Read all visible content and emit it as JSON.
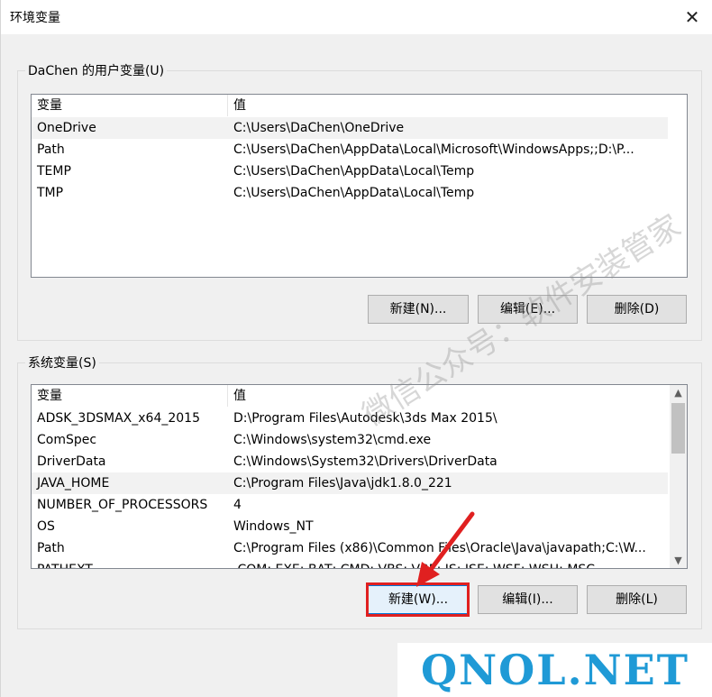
{
  "window": {
    "title": "环境变量",
    "close_glyph": "✕"
  },
  "user_vars": {
    "group_label": "DaChen 的用户变量(U)",
    "headers": [
      "变量",
      "值"
    ],
    "rows": [
      {
        "name": "OneDrive",
        "value": "C:\\Users\\DaChen\\OneDrive",
        "selected": true
      },
      {
        "name": "Path",
        "value": "C:\\Users\\DaChen\\AppData\\Local\\Microsoft\\WindowsApps;;D:\\P...",
        "selected": false
      },
      {
        "name": "TEMP",
        "value": "C:\\Users\\DaChen\\AppData\\Local\\Temp",
        "selected": false
      },
      {
        "name": "TMP",
        "value": "C:\\Users\\DaChen\\AppData\\Local\\Temp",
        "selected": false
      }
    ],
    "buttons": {
      "new": "新建(N)...",
      "edit": "编辑(E)...",
      "delete": "删除(D)"
    }
  },
  "system_vars": {
    "group_label": "系统变量(S)",
    "headers": [
      "变量",
      "值"
    ],
    "rows": [
      {
        "name": "ADSK_3DSMAX_x64_2015",
        "value": "D:\\Program Files\\Autodesk\\3ds Max 2015\\"
      },
      {
        "name": "ComSpec",
        "value": "C:\\Windows\\system32\\cmd.exe"
      },
      {
        "name": "DriverData",
        "value": "C:\\Windows\\System32\\Drivers\\DriverData"
      },
      {
        "name": "JAVA_HOME",
        "value": "C:\\Program Files\\Java\\jdk1.8.0_221"
      },
      {
        "name": "NUMBER_OF_PROCESSORS",
        "value": "4"
      },
      {
        "name": "OS",
        "value": "Windows_NT"
      },
      {
        "name": "Path",
        "value": "C:\\Program Files (x86)\\Common Files\\Oracle\\Java\\javapath;C:\\W..."
      },
      {
        "name": "PATHEXT",
        "value": ".COM;.EXE;.BAT;.CMD;.VBS;.VBE;.JS;.JSE;.WSF;.WSH;.MSC"
      }
    ],
    "buttons": {
      "new": "新建(W)...",
      "edit": "编辑(I)...",
      "delete": "删除(L)"
    }
  },
  "overlay": {
    "watermark": "微信公众号：软件安装管家",
    "brand": "QNOL.NET",
    "highlight_color": "#e02020"
  }
}
